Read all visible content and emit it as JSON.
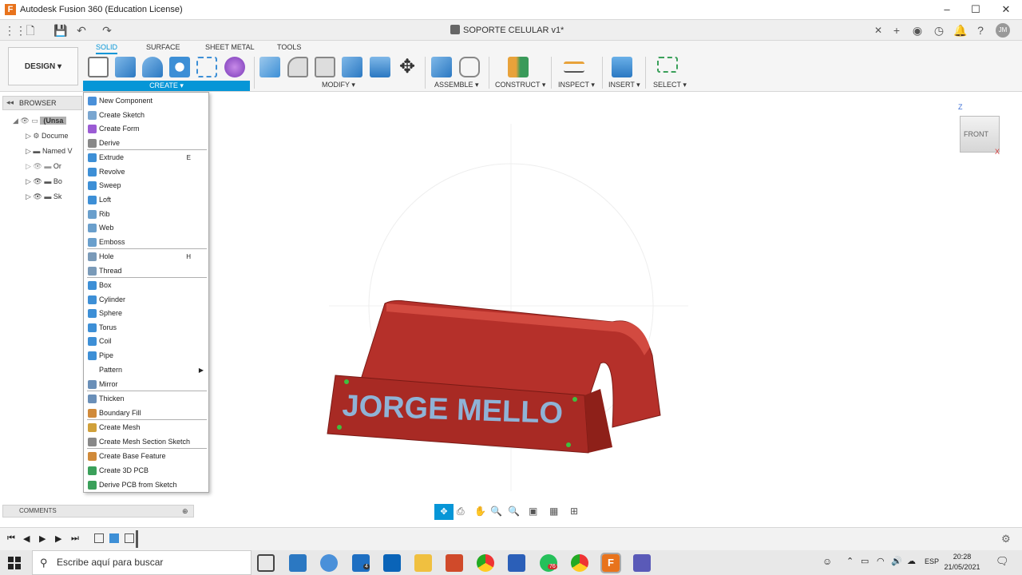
{
  "window": {
    "title": "Autodesk Fusion 360 (Education License)",
    "app_letter": "F"
  },
  "document": {
    "title": "SOPORTE CELULAR v1*"
  },
  "workspace": {
    "label": "DESIGN ▾"
  },
  "ribbon": {
    "tabs": [
      {
        "label": "SOLID",
        "active": true
      },
      {
        "label": "SURFACE"
      },
      {
        "label": "SHEET METAL"
      },
      {
        "label": "TOOLS"
      }
    ],
    "groups": {
      "create": "CREATE ▾",
      "modify": "MODIFY ▾",
      "assemble": "ASSEMBLE ▾",
      "construct": "CONSTRUCT ▾",
      "inspect": "INSPECT ▾",
      "insert": "INSERT ▾",
      "select": "SELECT ▾"
    }
  },
  "browser": {
    "title": "BROWSER",
    "items": [
      {
        "label": "(Unsa"
      },
      {
        "label": "Docume"
      },
      {
        "label": "Named V"
      },
      {
        "label": "Or"
      },
      {
        "label": "Bo"
      },
      {
        "label": "Sk"
      }
    ]
  },
  "create_menu": {
    "items": [
      {
        "label": "New Component",
        "icon": "new-component-icon",
        "color": "#4a90d9"
      },
      {
        "label": "Create Sketch",
        "icon": "sketch-icon",
        "color": "#7aa6d0"
      },
      {
        "label": "Create Form",
        "icon": "form-icon",
        "color": "#9b5bd4"
      },
      {
        "label": "Derive",
        "icon": "derive-icon",
        "color": "#888888"
      },
      {
        "label": "Extrude",
        "shortcut": "E",
        "icon": "extrude-icon",
        "color": "#3d8fd6"
      },
      {
        "label": "Revolve",
        "icon": "revolve-icon",
        "color": "#3d8fd6"
      },
      {
        "label": "Sweep",
        "icon": "sweep-icon",
        "color": "#3d8fd6"
      },
      {
        "label": "Loft",
        "icon": "loft-icon",
        "color": "#3d8fd6"
      },
      {
        "label": "Rib",
        "icon": "rib-icon",
        "color": "#6a9fcc"
      },
      {
        "label": "Web",
        "icon": "web-icon",
        "color": "#6a9fcc"
      },
      {
        "label": "Emboss",
        "icon": "emboss-icon",
        "color": "#6a9fcc"
      },
      {
        "label": "Hole",
        "shortcut": "H",
        "icon": "hole-icon",
        "color": "#7a9ab8"
      },
      {
        "label": "Thread",
        "icon": "thread-icon",
        "color": "#7a9ab8"
      },
      {
        "label": "Box",
        "icon": "box-icon",
        "color": "#3d8fd6"
      },
      {
        "label": "Cylinder",
        "icon": "cylinder-icon",
        "color": "#3d8fd6"
      },
      {
        "label": "Sphere",
        "icon": "sphere-icon",
        "color": "#3d8fd6"
      },
      {
        "label": "Torus",
        "icon": "torus-icon",
        "color": "#3d8fd6"
      },
      {
        "label": "Coil",
        "icon": "coil-icon",
        "color": "#3d8fd6"
      },
      {
        "label": "Pipe",
        "icon": "pipe-icon",
        "color": "#3d8fd6"
      },
      {
        "label": "Pattern",
        "submenu": true
      },
      {
        "label": "Mirror",
        "icon": "mirror-icon",
        "color": "#6a8fb8"
      },
      {
        "label": "Thicken",
        "icon": "thicken-icon",
        "color": "#6a8fb8"
      },
      {
        "label": "Boundary Fill",
        "icon": "boundary-fill-icon",
        "color": "#d08a3a"
      },
      {
        "label": "Create Mesh",
        "icon": "mesh-icon",
        "color": "#d0a03a"
      },
      {
        "label": "Create Mesh Section Sketch",
        "icon": "mesh-section-icon",
        "color": "#888888"
      },
      {
        "label": "Create Base Feature",
        "icon": "base-feature-icon",
        "color": "#d08a3a"
      },
      {
        "label": "Create 3D PCB",
        "icon": "pcb-icon",
        "color": "#3aa05a"
      },
      {
        "label": "Derive PCB from Sketch",
        "icon": "derive-pcb-icon",
        "color": "#3aa05a"
      }
    ]
  },
  "viewport": {
    "model_text": "JORGE MELLO",
    "viewcube": {
      "face": "FRONT",
      "axis_z": "Z",
      "axis_x": "X"
    }
  },
  "comments": {
    "label": "COMMENTS"
  },
  "taskbar": {
    "search_placeholder": "Escribe aquí para buscar",
    "mail_badge": "4",
    "whatsapp_badge": "76",
    "language": "ESP",
    "time": "20:28",
    "date": "21/05/2021"
  },
  "colors": {
    "accent": "#0696d7",
    "model": "#b5302a"
  }
}
